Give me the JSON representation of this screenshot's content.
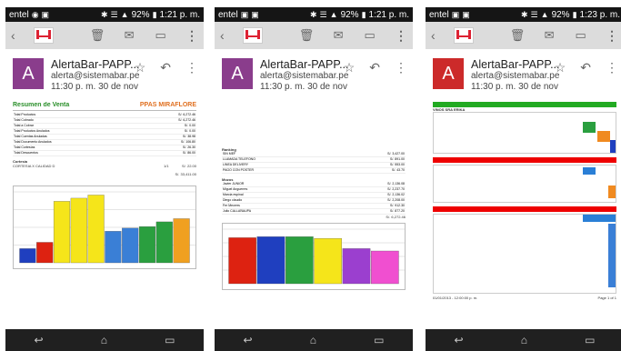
{
  "screens": [
    {
      "status": {
        "carrier": "entel",
        "battery": "92%",
        "time": "1:21 p. m."
      },
      "header": {
        "avatar_letter": "A",
        "sender": "AlertaBar-PAPP...",
        "email": "alerta@sistemabar.pe",
        "datetime": "11:30 p. m. 30 de nov"
      },
      "report": {
        "title": "Resumen de Venta",
        "store": "PPAS MIRAFLORE",
        "summary_rows": [
          {
            "label": "Total Productos",
            "value": "S/. 6,272.46"
          },
          {
            "label": "Total Cobrado",
            "value": "S/. 6,272.46"
          },
          {
            "label": "Total a Cobrar",
            "value": "S/. 0.00"
          },
          {
            "label": "Total Productos Anulados",
            "value": "S/. 0.00"
          },
          {
            "label": "Total Cuentas Anuladas",
            "value": "S/. 38.98"
          },
          {
            "label": "Total Documento Anulados",
            "value": "S/. 106.80"
          },
          {
            "label": "Total Cortesías",
            "value": "S/. 26.30"
          },
          {
            "label": "Total Descuentos",
            "value": "S/. 86.00"
          }
        ],
        "cortesia": {
          "label": "Cortesía",
          "line": "CORTESIA X CALIDAD D",
          "qty": "1/1",
          "value": "S/. 22.00"
        },
        "promedio_total": "S/. 33,411.00"
      },
      "chart_data": {
        "type": "bar",
        "categories": [
          "1",
          "2",
          "3",
          "4",
          "5",
          "6",
          "7",
          "8",
          "9",
          "10"
        ],
        "values": [
          1800,
          2600,
          7800,
          8200,
          8600,
          4000,
          4400,
          4600,
          5200,
          5600
        ],
        "colors": [
          "#1f3fbf",
          "#d21",
          "#f5e51a",
          "#f5e51a",
          "#f5e51a",
          "#3a7fd6",
          "#3a7fd6",
          "#2a9f3f",
          "#2a9f3f",
          "#f0a020"
        ],
        "ylim": [
          0,
          9000
        ]
      }
    },
    {
      "status": {
        "carrier": "entel",
        "battery": "92%",
        "time": "1:21 p. m."
      },
      "header": {
        "avatar_letter": "A",
        "sender": "AlertaBar-PAPP...",
        "email": "alerta@sistemabar.pe",
        "datetime": "11:30 p. m. 30 de nov"
      },
      "report": {
        "ranking": "Ranking",
        "ranking_rows": [
          {
            "name": "SIN MEF",
            "value": "S/. 3,427.00"
          },
          {
            "name": "LLAMADA TELEFONO",
            "value": "S/. 891.00"
          },
          {
            "name": "LINEA DELIVERY",
            "value": "S/. 553.00"
          },
          {
            "name": "PAGO CON POSTER",
            "value": "S/. 43.70"
          }
        ],
        "mozos": "Mozos",
        "mozos_rows": [
          {
            "name": "Javier JUNIOR",
            "value": "S/. 2,136.08"
          },
          {
            "name": "Miguel Anguerres",
            "value": "S/. 2,237.70"
          },
          {
            "name": "Marcia espinal",
            "value": "S/. 2,136.02"
          },
          {
            "name": "Diego claudio",
            "value": "S/. 2,208.00"
          },
          {
            "name": "Fer Mecerrs",
            "value": "S/. 912.30"
          },
          {
            "name": "Julio CALLAÑAUPA",
            "value": "S/. 877.20"
          }
        ],
        "mozos_total": "S/. 6,272.46"
      },
      "chart_data": {
        "type": "bar",
        "categories": [
          "Javier",
          "Miguel",
          "Marcia",
          "Diego",
          "Fer",
          "Julio"
        ],
        "values": [
          1350,
          1380,
          1380,
          1330,
          1030,
          960
        ],
        "colors": [
          "#d21",
          "#1f3fbf",
          "#2a9f3f",
          "#f5e51a",
          "#9b3fcf",
          "#f04fd0"
        ],
        "ylim": [
          0,
          1600
        ]
      }
    },
    {
      "status": {
        "carrier": "entel",
        "battery": "92%",
        "time": "1:23 p. m."
      },
      "header": {
        "avatar_letter": "A",
        "sender": "AlertaBar-PAPP...",
        "email": "alerta@sistemabar.pe",
        "datetime": "11:30 p. m. 30 de nov"
      },
      "report": {
        "section1_title": "Sección",
        "section1_sub": "VINOS SRA ERIKA",
        "section2_title": "Postres",
        "section3_title": "Fondos",
        "footer": "Page 1 of 1",
        "footer_left": "01/01/2013 - 12:00:00 p. m."
      }
    }
  ],
  "nav": {
    "back_icon": "back-icon",
    "home_icon": "home-icon",
    "recent_icon": "recent-apps-icon"
  }
}
